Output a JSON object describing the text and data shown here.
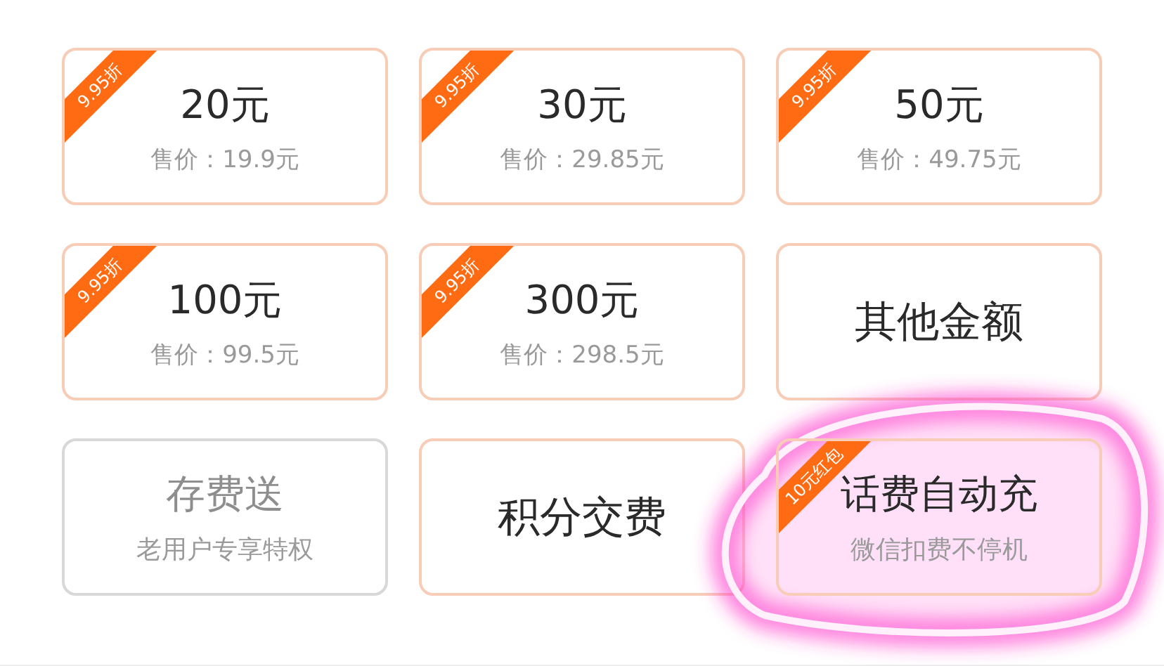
{
  "cards": [
    {
      "kind": "price",
      "title": "20元",
      "subtitle": "售价：19.9元",
      "tag": "9.95折",
      "disabled": false,
      "highlighted": false
    },
    {
      "kind": "price",
      "title": "30元",
      "subtitle": "售价：29.85元",
      "tag": "9.95折",
      "disabled": false,
      "highlighted": false
    },
    {
      "kind": "price",
      "title": "50元",
      "subtitle": "售价：49.75元",
      "tag": "9.95折",
      "disabled": false,
      "highlighted": false
    },
    {
      "kind": "price",
      "title": "100元",
      "subtitle": "售价：99.5元",
      "tag": "9.95折",
      "disabled": false,
      "highlighted": false
    },
    {
      "kind": "price",
      "title": "300元",
      "subtitle": "售价：298.5元",
      "tag": "9.95折",
      "disabled": false,
      "highlighted": false
    },
    {
      "kind": "single",
      "title": "其他金额",
      "disabled": false,
      "highlighted": false
    },
    {
      "kind": "promo",
      "title": "存费送",
      "subtitle": "老用户专享特权",
      "disabled": true,
      "highlighted": false
    },
    {
      "kind": "single",
      "title": "积分交费",
      "disabled": false,
      "highlighted": false
    },
    {
      "kind": "promo",
      "title": "话费自动充",
      "subtitle": "微信扣费不停机",
      "tag": "10元红包",
      "disabled": false,
      "highlighted": true
    }
  ]
}
